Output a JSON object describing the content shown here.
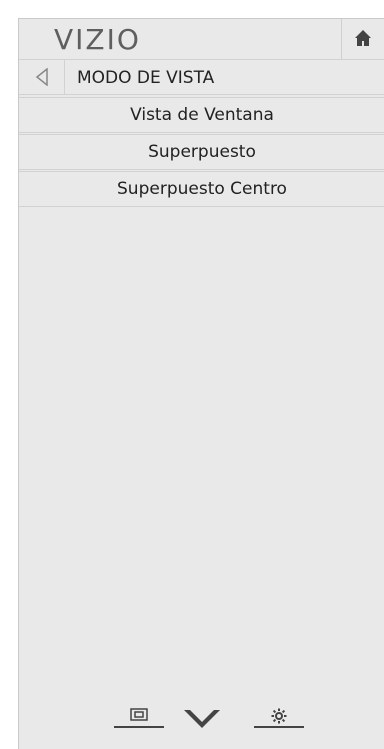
{
  "brand": {
    "logo": "VIZIO"
  },
  "header": {
    "home_icon": "home-icon"
  },
  "menu": {
    "title": "MODO DE VISTA",
    "back_icon": "back-arrow-icon",
    "items": [
      {
        "label": "Vista de Ventana"
      },
      {
        "label": "Superpuesto"
      },
      {
        "label": "Superpuesto Centro"
      }
    ]
  },
  "bottom_nav": {
    "tabs": [
      {
        "icon": "input-icon"
      },
      {
        "icon": "chevron-down-icon"
      },
      {
        "icon": "gear-icon"
      }
    ]
  }
}
